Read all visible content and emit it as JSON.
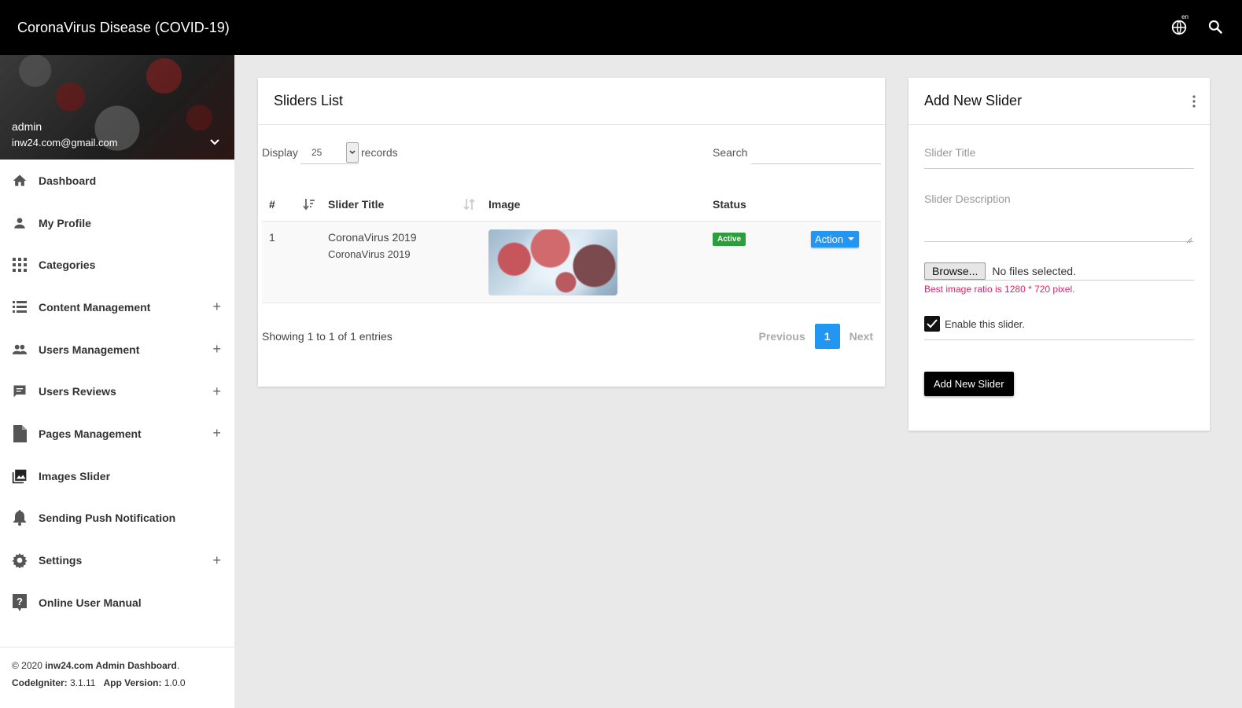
{
  "app": {
    "title": "CoronaVirus Disease (COVID-19)",
    "lang_badge": "en"
  },
  "topbar": {
    "icons": [
      "globe-icon",
      "search-icon"
    ]
  },
  "user": {
    "name": "admin",
    "email": "inw24.com@gmail.com"
  },
  "sidebar": {
    "items": [
      {
        "label": "Dashboard",
        "icon": "home-icon",
        "expandable": false
      },
      {
        "label": "My Profile",
        "icon": "person-icon",
        "expandable": false
      },
      {
        "label": "Categories",
        "icon": "apps-grid-icon",
        "expandable": false
      },
      {
        "label": "Content Management",
        "icon": "list-icon",
        "expandable": true
      },
      {
        "label": "Users Management",
        "icon": "people-icon",
        "expandable": true
      },
      {
        "label": "Users Reviews",
        "icon": "comment-icon",
        "expandable": true
      },
      {
        "label": "Pages Management",
        "icon": "document-icon",
        "expandable": true
      },
      {
        "label": "Images Slider",
        "icon": "images-icon",
        "expandable": false
      },
      {
        "label": "Sending Push Notification",
        "icon": "bell-icon",
        "expandable": false
      },
      {
        "label": "Settings",
        "icon": "gear-icon",
        "expandable": true
      },
      {
        "label": "Online User Manual",
        "icon": "help-icon",
        "expandable": false
      }
    ],
    "plus": "+"
  },
  "footer": {
    "copyright": "© 2020 ",
    "brand": "inw24.com Admin Dashboard",
    "period": ".",
    "ci_label": "CodeIgniter:",
    "ci_version": " 3.1.11",
    "app_label": "App Version:",
    "app_version": " 1.0.0"
  },
  "list": {
    "title": "Sliders List",
    "display_label": "Display",
    "display_value": "25",
    "records_label": "records",
    "search_label": "Search",
    "search_value": "",
    "columns": [
      "#",
      "Slider Title",
      "Image",
      "Status"
    ],
    "rows": [
      {
        "num": "1",
        "title": "CoronaVirus 2019",
        "subtitle": "CoronaVirus 2019",
        "status": "Active",
        "action": "Action"
      }
    ],
    "info": "Showing 1 to 1 of 1 entries",
    "pager": {
      "prev": "Previous",
      "page": "1",
      "next": "Next"
    }
  },
  "form": {
    "title": "Add New Slider",
    "title_placeholder": "Slider Title",
    "desc_placeholder": "Slider Description",
    "browse_label": "Browse...",
    "file_status": "No files selected.",
    "hint": "Best image ratio is 1280 * 720 pixel.",
    "enable_label": "Enable this slider.",
    "enable_checked": true,
    "submit_label": "Add New Slider"
  },
  "colors": {
    "accent": "#2196f3",
    "active": "#2b9f3b",
    "hint": "#e91e63",
    "topbar": "#000000"
  }
}
